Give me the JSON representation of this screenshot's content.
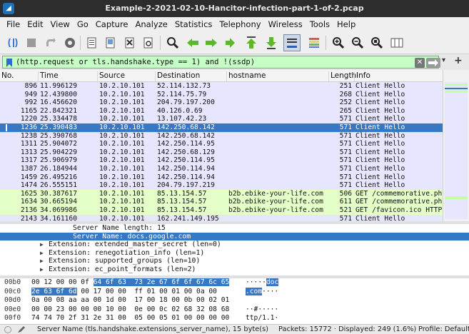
{
  "window": {
    "title": "Example-2-2021-02-10-Hancitor-infection-part-1-of-2.pcap"
  },
  "menu": [
    "File",
    "Edit",
    "View",
    "Go",
    "Capture",
    "Analyze",
    "Statistics",
    "Telephony",
    "Wireless",
    "Tools",
    "Help"
  ],
  "toolbar_icons": [
    "start-capture-icon",
    "stop-capture-icon",
    "restart-capture-icon",
    "capture-options-icon",
    "open-file-icon",
    "save-file-icon",
    "close-file-icon",
    "reload-file-icon",
    "find-packet-icon",
    "go-back-icon",
    "go-forward-icon",
    "go-to-packet-icon",
    "go-first-icon",
    "go-last-icon",
    "autoscroll-icon",
    "colorize-icon",
    "zoom-in-icon",
    "zoom-out-icon",
    "zoom-reset-icon",
    "resize-columns-icon"
  ],
  "filter": {
    "text": "(http.request or tls.handshake.type == 1) and !(ssdp)"
  },
  "columns": [
    "No.",
    "Time",
    "Source",
    "Destination",
    "hostname",
    "Length",
    "Info"
  ],
  "packets": [
    {
      "no": "896",
      "time": "11.996129",
      "src": "10.2.10.101",
      "dst": "52.114.132.73",
      "host": "",
      "len": "251",
      "info": "Client Hello",
      "cls": "tls"
    },
    {
      "no": "949",
      "time": "12.439800",
      "src": "10.2.10.101",
      "dst": "52.114.75.79",
      "host": "",
      "len": "268",
      "info": "Client Hello",
      "cls": "tls"
    },
    {
      "no": "992",
      "time": "16.456620",
      "src": "10.2.10.101",
      "dst": "204.79.197.200",
      "host": "",
      "len": "252",
      "info": "Client Hello",
      "cls": "tls"
    },
    {
      "no": "1165",
      "time": "22.842321",
      "src": "10.2.10.101",
      "dst": "40.126.0.69",
      "host": "",
      "len": "265",
      "info": "Client Hello",
      "cls": "tls"
    },
    {
      "no": "1220",
      "time": "25.334478",
      "src": "10.2.10.101",
      "dst": "13.107.42.23",
      "host": "",
      "len": "571",
      "info": "Client Hello",
      "cls": "tls"
    },
    {
      "no": "1236",
      "time": "25.390483",
      "src": "10.2.10.101",
      "dst": "142.250.68.142",
      "host": "",
      "len": "571",
      "info": "Client Hello",
      "cls": "sel"
    },
    {
      "no": "1238",
      "time": "25.390768",
      "src": "10.2.10.101",
      "dst": "142.250.68.142",
      "host": "",
      "len": "571",
      "info": "Client Hello",
      "cls": "tls"
    },
    {
      "no": "1311",
      "time": "25.904072",
      "src": "10.2.10.101",
      "dst": "142.250.114.95",
      "host": "",
      "len": "571",
      "info": "Client Hello",
      "cls": "tls"
    },
    {
      "no": "1313",
      "time": "25.904229",
      "src": "10.2.10.101",
      "dst": "142.250.68.129",
      "host": "",
      "len": "571",
      "info": "Client Hello",
      "cls": "tls"
    },
    {
      "no": "1317",
      "time": "25.906979",
      "src": "10.2.10.101",
      "dst": "142.250.114.95",
      "host": "",
      "len": "571",
      "info": "Client Hello",
      "cls": "tls"
    },
    {
      "no": "1387",
      "time": "26.184944",
      "src": "10.2.10.101",
      "dst": "142.250.114.94",
      "host": "",
      "len": "571",
      "info": "Client Hello",
      "cls": "tls"
    },
    {
      "no": "1459",
      "time": "26.495216",
      "src": "10.2.10.101",
      "dst": "142.250.114.94",
      "host": "",
      "len": "571",
      "info": "Client Hello",
      "cls": "tls"
    },
    {
      "no": "1474",
      "time": "26.555151",
      "src": "10.2.10.101",
      "dst": "204.79.197.219",
      "host": "",
      "len": "571",
      "info": "Client Hello",
      "cls": "tls"
    },
    {
      "no": "1625",
      "time": "30.387617",
      "src": "10.2.10.101",
      "dst": "85.13.154.57",
      "host": "b2b.ebike-your-life.com",
      "len": "506",
      "info": "GET /commemorative.ph",
      "cls": "http"
    },
    {
      "no": "1634",
      "time": "30.665194",
      "src": "10.2.10.101",
      "dst": "85.13.154.57",
      "host": "b2b.ebike-your-life.com",
      "len": "611",
      "info": "GET /commemorative.ph",
      "cls": "http"
    },
    {
      "no": "2136",
      "time": "34.069986",
      "src": "10.2.10.101",
      "dst": "85.13.154.57",
      "host": "b2b.ebike-your-life.com",
      "len": "521",
      "info": "GET /favicon.ico HTTP",
      "cls": "http"
    },
    {
      "no": "2143",
      "time": "34.161160",
      "src": "10.2.10.101",
      "dst": "162.241.149.195",
      "host": "",
      "len": "571",
      "info": "Client Hello",
      "cls": "tls"
    }
  ],
  "details": [
    {
      "text": "Server Name length: 15",
      "indent": 102,
      "tri": false,
      "sel": false
    },
    {
      "text": "Server Name: docs.google.com",
      "indent": 102,
      "tri": false,
      "sel": true
    },
    {
      "text": "Extension: extended_master_secret (len=0)",
      "indent": 68,
      "tri": true,
      "sel": false
    },
    {
      "text": "Extension: renegotiation_info (len=1)",
      "indent": 68,
      "tri": true,
      "sel": false
    },
    {
      "text": "Extension: supported_groups (len=10)",
      "indent": 68,
      "tri": true,
      "sel": false
    },
    {
      "text": "Extension: ec_point_formats (len=2)",
      "indent": 68,
      "tri": true,
      "sel": false
    }
  ],
  "bytes": [
    {
      "off": "00b0",
      "hex_a": "00 12 00 00 0f ",
      "hex_hl": "64 6f 63  73 2e 67 6f 6f 67 6c 65",
      "hex_b": "",
      "asc_a": "·····",
      "asc_hl": "doc",
      "asc_b": ""
    },
    {
      "off": "00c0",
      "hex_a": "",
      "hex_hl": "2e 63 6f 6d",
      "hex_b": " 00 17 00 00  ff 01 00 01 00 0a 00",
      "asc_a": "",
      "asc_hl": ".com",
      "asc_b": "····"
    },
    {
      "off": "00d0",
      "hex_a": "0a 00 08 aa aa 00 1d 00  17 00 18 00 0b 00 02 01",
      "hex_hl": "",
      "hex_b": "",
      "asc_a": "",
      "asc_hl": "",
      "asc_b": ""
    },
    {
      "off": "00e0",
      "hex_a": "00 00 23 00 00 00 10 00  0e 00 0c 02 68 32 08 68",
      "hex_hl": "",
      "hex_b": "",
      "asc_a": "··#·····",
      "asc_hl": "",
      "asc_b": ""
    },
    {
      "off": "00f0",
      "hex_a": "74 74 70 2f 31 2e 31 00  05 00 05 01 00 00 00 00",
      "hex_hl": "",
      "hex_b": "",
      "asc_a": "ttp/1.1·",
      "asc_hl": "",
      "asc_b": ""
    }
  ],
  "status": {
    "field": "Server Name (tls.handshake.extensions_server_name), 15 byte(s)",
    "packets": "Packets: 15772 · Displayed: 249 (1.6%)",
    "profile": "Profile: Default"
  }
}
